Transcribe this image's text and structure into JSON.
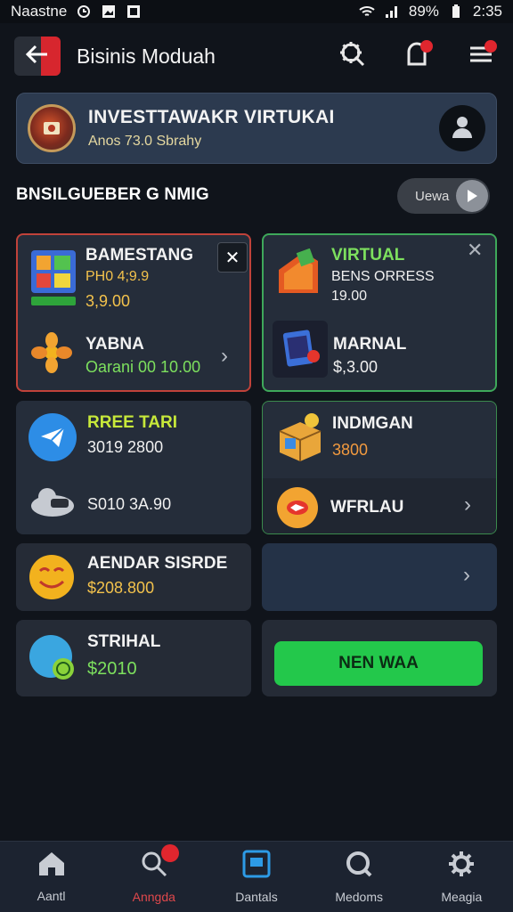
{
  "status_bar": {
    "carrier": "Naastne",
    "battery": "89%",
    "time": "2:35"
  },
  "header": {
    "title": "Bisinis Moduah",
    "icons": [
      "back-icon",
      "gear-icon",
      "notification-icon",
      "menu-icon"
    ]
  },
  "investment": {
    "title": "INVESTTAWAKR VIRTUKAI",
    "subtitle": "Anos 73.0 Sbrahy"
  },
  "section": {
    "title": "BNSILGUEBER G NMIG",
    "view_label": "Uewa"
  },
  "cards": {
    "gamestang": {
      "title": "BAMESTANG",
      "subtitle": "PH0 4;9.9",
      "value": "3,9.00"
    },
    "yabna": {
      "title": "YABNA",
      "subtitle": "Oarani 00 10.00"
    },
    "virtual": {
      "title": "VIRTUAL",
      "subtitle": "BENS ORRESS",
      "value": "19.00"
    },
    "marnal": {
      "title": "MARNAL",
      "value": "$,3.00"
    },
    "free_tari": {
      "title": "RREE TARI",
      "value": "3019 2800"
    },
    "sooo": {
      "value": "S010 3A.90"
    },
    "indmgan": {
      "title": "INDMGAN",
      "value": "3800"
    },
    "wfrlau": {
      "title": "WFRLAU"
    },
    "aendar": {
      "title": "AENDAR SISRDE",
      "value": "$208.800"
    },
    "strihal": {
      "title": "STRIHAL",
      "value": "$2010"
    },
    "new_button": "NEN WAA"
  },
  "nav": {
    "items": [
      {
        "label": "Aantl",
        "icon": "home-icon"
      },
      {
        "label": "Anngda",
        "icon": "search-icon"
      },
      {
        "label": "Dantals",
        "icon": "square-icon"
      },
      {
        "label": "Medoms",
        "icon": "search-icon"
      },
      {
        "label": "Meagia",
        "icon": "gear-icon"
      }
    ],
    "active_index": 1
  },
  "colors": {
    "background": "#10141b",
    "accent_red": "#e0262e",
    "accent_green": "#23c84b",
    "card": "#252d3a"
  }
}
